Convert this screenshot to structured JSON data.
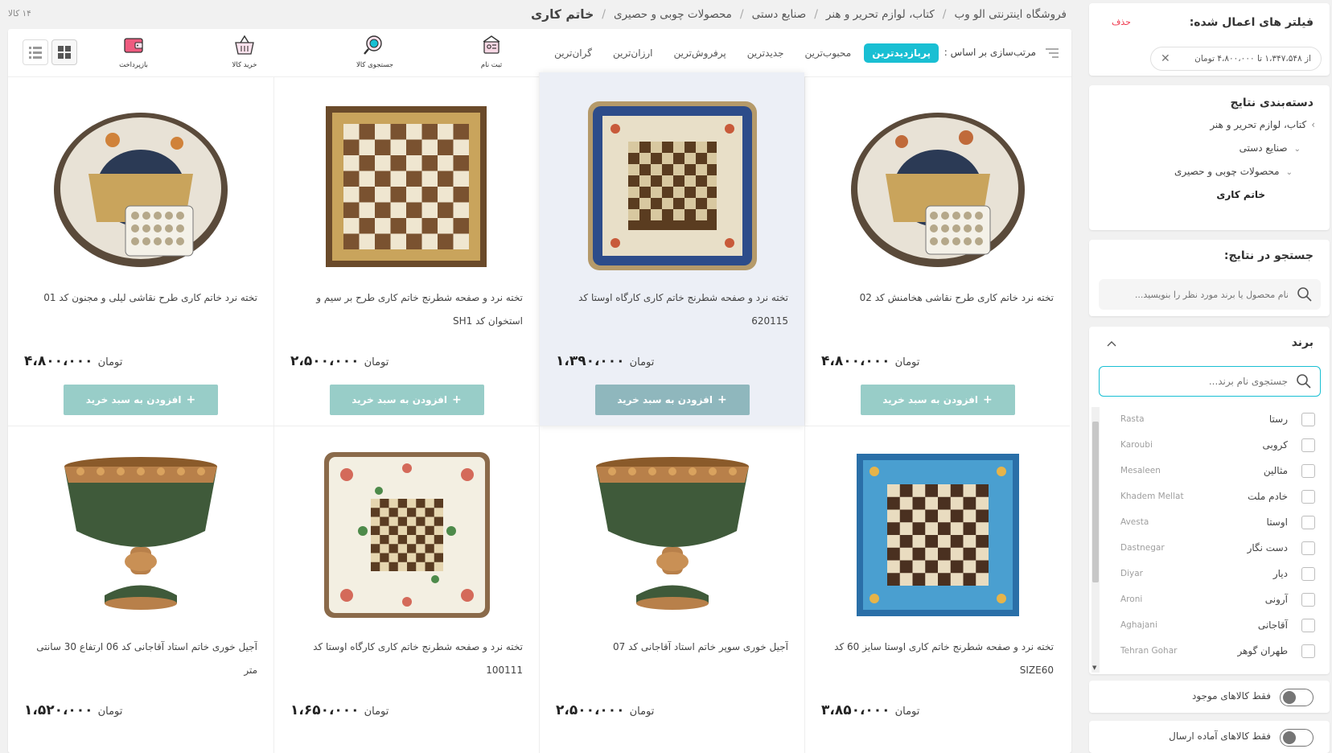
{
  "breadcrumb": {
    "items": [
      "فروشگاه اینترنتی الو وب",
      "کتاب، لوازم تحریر و هنر",
      "صنایع دستی",
      "محصولات چوبی و حصیری",
      "خاتم کاری"
    ],
    "separator": "/"
  },
  "product_count": "۱۴ کالا",
  "filters": {
    "title": "فیلتر های اعمال شده:",
    "remove_label": "حذف",
    "chip": "از ۱،۳۴۷،۵۴۸ تا ۴،۸۰۰،۰۰۰ تومان"
  },
  "categories": {
    "title": "دسته‌بندی نتایج",
    "items": [
      "کتاب، لوازم تحریر و هنر",
      "صنایع دستی",
      "محصولات چوبی و حصیری",
      "خاتم کاری"
    ]
  },
  "search": {
    "title": "جستجو در نتایج:",
    "placeholder": "نام محصول یا برند مورد نظر را بنویسید..."
  },
  "brands": {
    "title": "برند",
    "placeholder": "جستجوی نام برند...",
    "items": [
      {
        "fa": "رستا",
        "en": "Rasta"
      },
      {
        "fa": "کروبی",
        "en": "Karoubi"
      },
      {
        "fa": "مثالین",
        "en": "Mesaleen"
      },
      {
        "fa": "خادم ملت",
        "en": "Khadem Mellat"
      },
      {
        "fa": "اوستا",
        "en": "Avesta"
      },
      {
        "fa": "دست نگار",
        "en": "Dastnegar"
      },
      {
        "fa": "دیار",
        "en": "Diyar"
      },
      {
        "fa": "آرونی",
        "en": "Aroni"
      },
      {
        "fa": "آقاجانی",
        "en": "Aghajani"
      },
      {
        "fa": "طهران گوهر",
        "en": "Tehran Gohar"
      }
    ]
  },
  "toggles": {
    "in_stock": "فقط کالاهای موجود",
    "ready_to_ship": "فقط کالاهای آماده ارسال"
  },
  "sort": {
    "label": "مرتب‌سازی بر اساس :",
    "options": [
      "پربازدیدترین",
      "محبوب‌ترین",
      "جدیدترین",
      "پرفروش‌ترین",
      "ارزان‌ترین",
      "گران‌ترین"
    ],
    "active_index": 0
  },
  "quick_actions": [
    "ثبت نام",
    "جستجوی کالا",
    "خرید کالا",
    "بازپرداخت"
  ],
  "add_to_cart_label": "افزودن به سبد خرید",
  "currency": "تومان",
  "products": [
    {
      "title": "تخته نرد خاتم کاری طرح نقاشی هخامنش کد 02",
      "price": "۴،۸۰۰،۰۰۰",
      "image": "round-backgammon"
    },
    {
      "title": "تخته نرد و صفحه شطرنج خاتم کاری کارگاه اوستا کد 620115",
      "price": "۱،۳۹۰،۰۰۰",
      "image": "ornate-chessboard-blue"
    },
    {
      "title": "تخته نرد و صفحه شطرنج خاتم کاری طرح بر سیم و استخوان کد SH1",
      "price": "۲،۵۰۰،۰۰۰",
      "image": "classic-chessboard"
    },
    {
      "title": "تخته نرد خاتم کاری طرح نقاشی لیلی و مجنون کد 01",
      "price": "۴،۸۰۰،۰۰۰",
      "image": "round-backgammon"
    },
    {
      "title": "تخته نرد و صفحه شطرنج خاتم کاری اوستا سایز 60 کد SIZE60",
      "price": "۳،۸۵۰،۰۰۰",
      "image": "square-chessboard-blue"
    },
    {
      "title": "آجیل خوری سوپر خاتم استاد آقاجانی کد 07",
      "price": "۲،۵۰۰،۰۰۰",
      "image": "nut-bowl"
    },
    {
      "title": "تخته نرد و صفحه شطرنج خاتم کاری کارگاه اوستا کد 100111",
      "price": "۱،۶۵۰،۰۰۰",
      "image": "floral-chessboard"
    },
    {
      "title": "آجیل خوری خاتم استاد آقاجانی کد 06 ارتفاع 30 سانتی متر",
      "price": "۱،۵۲۰،۰۰۰",
      "image": "nut-bowl"
    }
  ],
  "colors": {
    "accent": "#19bfd3",
    "remove": "#ef394e",
    "cart_button": "#98cdc8"
  }
}
